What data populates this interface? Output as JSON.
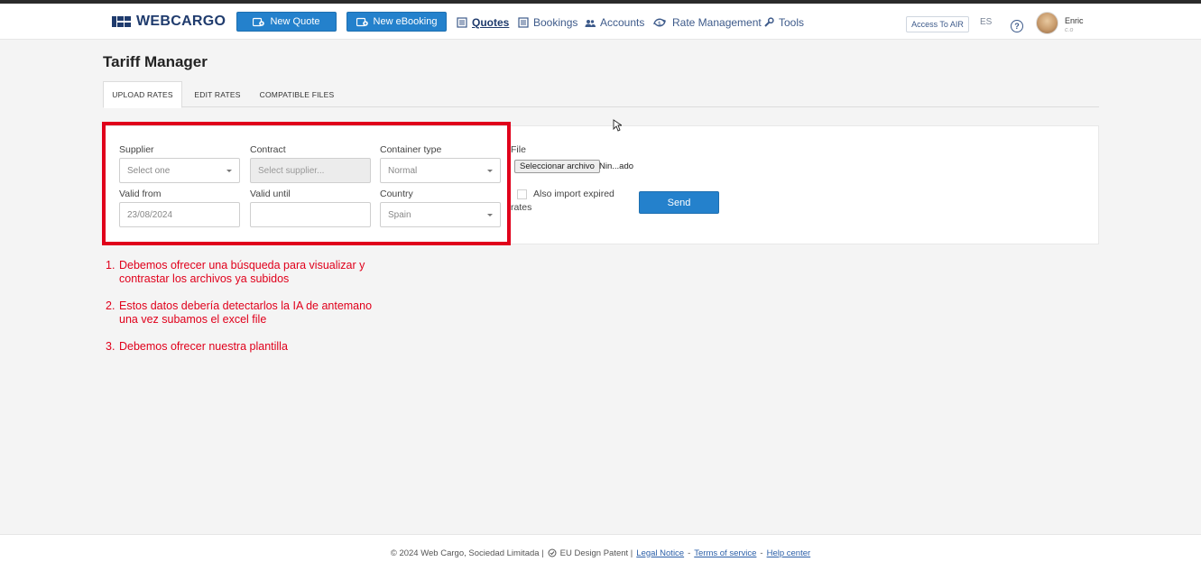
{
  "brand": {
    "name": "WEBCARGO",
    "color": "#1f3b6d"
  },
  "accent": "#2481cc",
  "annotation_color": "#e0001b",
  "navbar": {
    "new_quote": "New Quote",
    "new_ebooking": "New eBooking",
    "links": [
      {
        "label": "Quotes",
        "icon": "quotes-icon",
        "active": true
      },
      {
        "label": "Bookings",
        "icon": "bookings-icon",
        "active": false
      },
      {
        "label": "Accounts",
        "icon": "accounts-icon",
        "active": false
      },
      {
        "label": "Rate Management",
        "icon": "rate-management-icon",
        "active": false
      },
      {
        "label": "Tools",
        "icon": "wrench-icon",
        "active": false
      }
    ],
    "access_air": "Access To AIR",
    "language": "ES",
    "help": "?",
    "user_name": "Enric",
    "user_sub": "c.o"
  },
  "page": {
    "title": "Tariff Manager",
    "tabs": [
      {
        "label": "UPLOAD RATES",
        "active": true
      },
      {
        "label": "EDIT RATES",
        "active": false
      },
      {
        "label": "COMPATIBLE FILES",
        "active": false
      }
    ]
  },
  "form": {
    "supplier": {
      "label": "Supplier",
      "value": "Select one"
    },
    "contract": {
      "label": "Contract",
      "placeholder": "Select supplier..."
    },
    "container_type": {
      "label": "Container type",
      "value": "Normal"
    },
    "valid_from": {
      "label": "Valid from",
      "value": "23/08/2024"
    },
    "valid_until": {
      "label": "Valid until",
      "value": ""
    },
    "country": {
      "label": "Country",
      "value": "Spain"
    },
    "file": {
      "label": "File",
      "button": "Seleccionar archivo",
      "status": "Nin...ado"
    },
    "expired": {
      "label_line1": "Also import expired",
      "label_line2": "rates",
      "checked": false
    },
    "send": "Send"
  },
  "notes": [
    {
      "num": "1.",
      "text": "Debemos ofrecer una búsqueda para visualizar y contrastar los archivos ya subidos"
    },
    {
      "num": "2.",
      "text": "Estos datos debería detectarlos la IA de antemano una vez subamos el excel file"
    },
    {
      "num": "3.",
      "text": "Debemos ofrecer nuestra plantilla"
    }
  ],
  "footer": {
    "copyright": "© 2024 Web Cargo, Sociedad Limitada |",
    "patent": "EU Design Patent |",
    "legal": "Legal Notice",
    "sep1": "-",
    "terms": "Terms of service",
    "sep2": "-",
    "help": "Help center"
  }
}
